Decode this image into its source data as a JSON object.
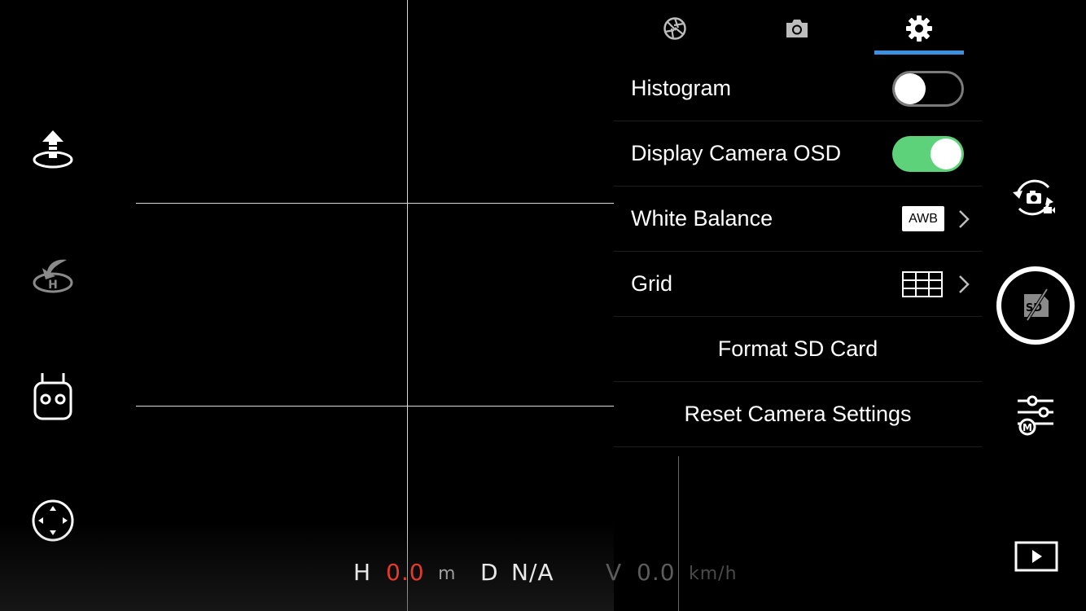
{
  "telemetry": {
    "h_label": "H",
    "h_value": "0.0",
    "h_unit": "m",
    "d_label": "D",
    "d_value": "N/A",
    "v_label": "V",
    "v_value": "0.0",
    "v_unit": "km/h"
  },
  "panel": {
    "tabs": [
      {
        "icon": "aperture-icon"
      },
      {
        "icon": "camera-icon"
      },
      {
        "icon": "gear-icon",
        "active": true
      }
    ],
    "rows": {
      "histogram": {
        "label": "Histogram",
        "on": false
      },
      "osd": {
        "label": "Display Camera OSD",
        "on": true
      },
      "white_balance": {
        "label": "White Balance",
        "value": "AWB"
      },
      "grid": {
        "label": "Grid"
      },
      "format": {
        "label": "Format SD Card"
      },
      "reset": {
        "label": "Reset Camera Settings"
      }
    }
  },
  "colors": {
    "accent": "#3d8fe0",
    "toggle_on": "#5ed27a",
    "alert": "#e53a2a"
  }
}
